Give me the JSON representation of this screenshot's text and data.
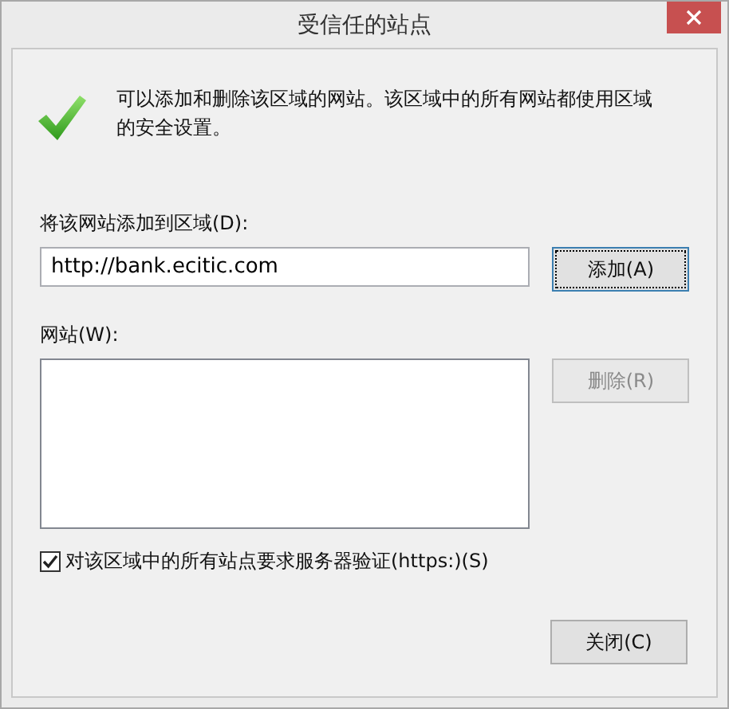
{
  "window": {
    "title": "受信任的站点"
  },
  "info": {
    "text": "可以添加和删除该区域的网站。该区域中的所有网站都使用区域的安全设置。"
  },
  "add_field": {
    "label": "将该网站添加到区域(D):",
    "value": "http://bank.ecitic.com"
  },
  "add_button": {
    "label": "添加(A)",
    "disabled": false
  },
  "sites": {
    "label": "网站(W):"
  },
  "remove_button": {
    "label": "删除(R)",
    "disabled": true
  },
  "https_checkbox": {
    "label": "对该区域中的所有站点要求服务器验证(https:)(S)",
    "checked": true
  },
  "close_button": {
    "label": "关闭(C)"
  }
}
